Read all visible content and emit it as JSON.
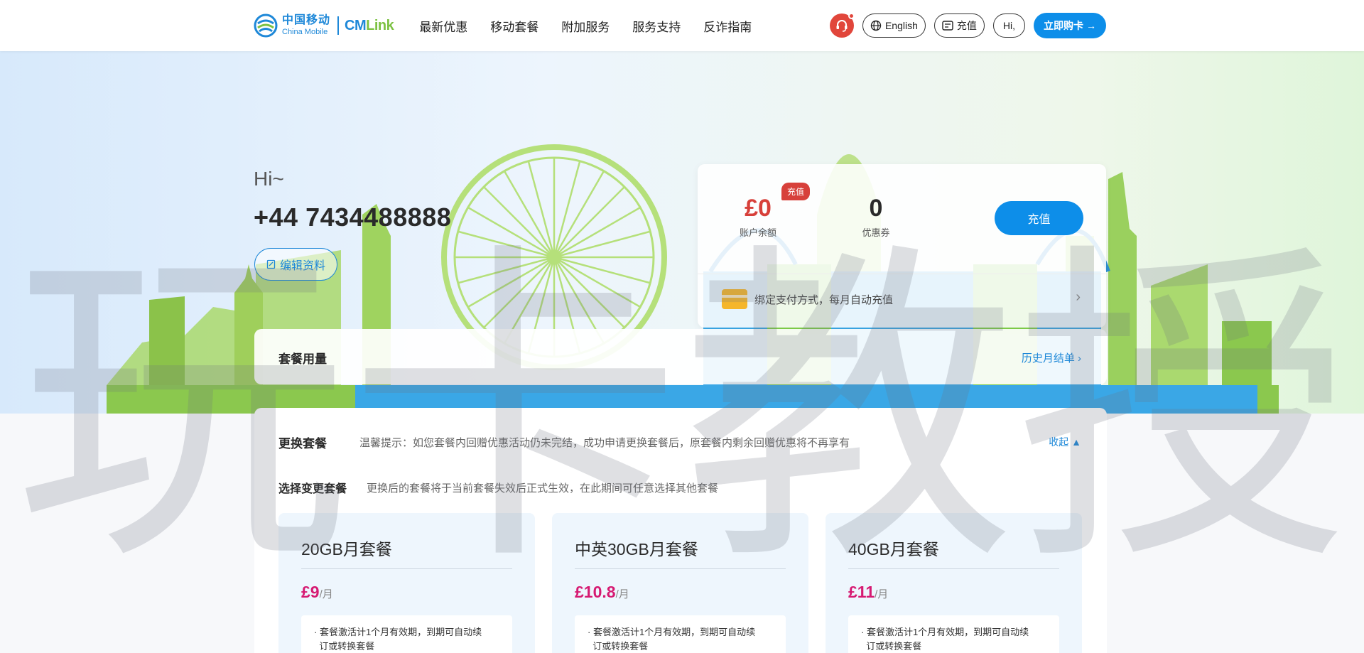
{
  "brand": {
    "logo_cn": "中国移动",
    "logo_en": "China Mobile",
    "cmlink": "CM",
    "cmlink_accent": "Link",
    "brand_color": "#1e88d8",
    "accent_green": "#7cc142"
  },
  "nav": {
    "items": [
      "最新优惠",
      "移动套餐",
      "附加服务",
      "服务支持",
      "反诈指南"
    ]
  },
  "header_tools": {
    "support_icon": "headset-icon",
    "language_label": "English",
    "topup_label": "充值",
    "hi_label": "Hi,",
    "buy_label": "立即购卡",
    "buy_color": "#0d8ee9"
  },
  "hero": {
    "greeting": "Hi~",
    "phone": "+44 7434488888",
    "edit_label": "编辑资料"
  },
  "account": {
    "balance": "£0",
    "balance_label": "账户余额",
    "badge": "充值",
    "coupons": "0",
    "coupons_label": "优惠券",
    "recharge_label": "充值",
    "autopay_text": "绑定支付方式，每月自动充值",
    "balance_color": "#d7403a"
  },
  "usage": {
    "title": "套餐用量",
    "history_link": "历史月结单"
  },
  "change_plan": {
    "title": "更换套餐",
    "tip": "温馨提示：如您套餐内回赠优惠活动仍未完结，成功申请更换套餐后，原套餐内剩余回赠优惠将不再享有",
    "collapse_label": "收起",
    "select_title": "选择变更套餐",
    "select_tip": "更换后的套餐将于当前套餐失效后正式生效，在此期间可任意选择其他套餐",
    "plans": [
      {
        "name": "20GB月套餐",
        "price": "£9",
        "unit": "/月",
        "desc_1": "套餐激活计1个月有效期，到期可自动续",
        "desc_2": "订或转换套餐"
      },
      {
        "name": "中英30GB月套餐",
        "price": "£10.8",
        "unit": "/月",
        "desc_1": "套餐激活计1个月有效期，到期可自动续",
        "desc_2": "订或转换套餐"
      },
      {
        "name": "40GB月套餐",
        "price": "£11",
        "unit": "/月",
        "desc_1": "套餐激活计1个月有效期，到期可自动续",
        "desc_2": "订或转换套餐"
      }
    ],
    "price_color": "#d61a72"
  },
  "watermark": {
    "text": "玩卡教授"
  }
}
